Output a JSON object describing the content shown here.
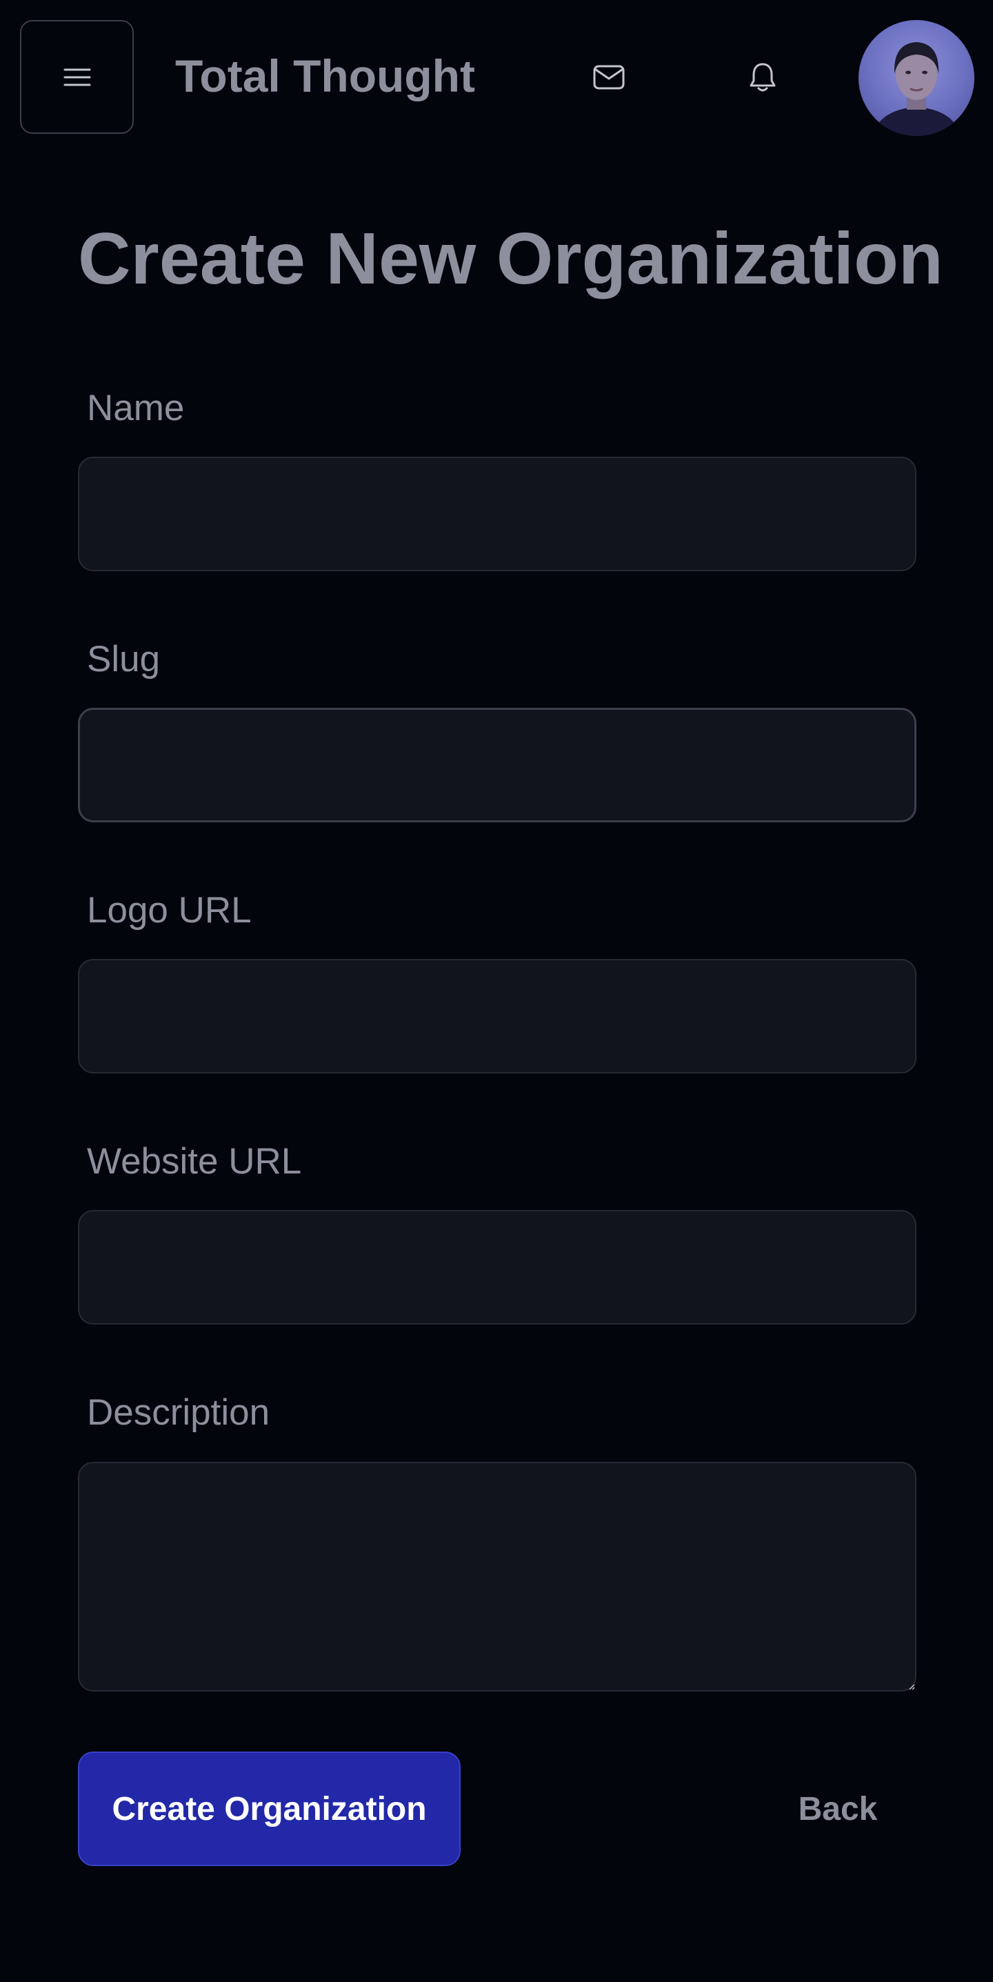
{
  "header": {
    "menu_icon": "hamburger-menu-icon",
    "app_title": "Total Thought",
    "mail_icon": "mail-icon",
    "bell_icon": "bell-icon",
    "avatar": "user-avatar"
  },
  "page": {
    "title": "Create New Organization"
  },
  "form": {
    "name": {
      "label": "Name",
      "value": "",
      "placeholder": ""
    },
    "slug": {
      "label": "Slug",
      "value": "",
      "placeholder": ""
    },
    "logo_url": {
      "label": "Logo URL",
      "value": "",
      "placeholder": ""
    },
    "website_url": {
      "label": "Website URL",
      "value": "",
      "placeholder": ""
    },
    "description": {
      "label": "Description",
      "value": "",
      "placeholder": ""
    }
  },
  "actions": {
    "create_label": "Create Organization",
    "back_label": "Back"
  },
  "colors": {
    "background": "#03050d",
    "input_background": "#10141c",
    "text_muted": "#8b909c",
    "primary_button": "#2228a8"
  }
}
